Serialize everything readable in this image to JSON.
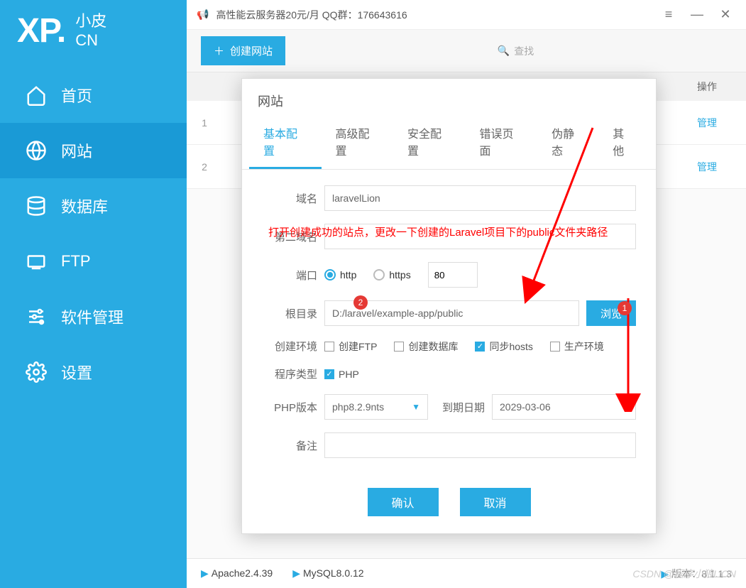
{
  "logo": {
    "xp": "XP.",
    "sub1": "小皮",
    "sub2": "CN"
  },
  "nav": {
    "home": "首页",
    "website": "网站",
    "database": "数据库",
    "ftp": "FTP",
    "software": "软件管理",
    "settings": "设置"
  },
  "titlebar": {
    "announce": "高性能云服务器20元/月  QQ群：176643616"
  },
  "topbar": {
    "create": "创建网站",
    "search": "查找"
  },
  "table": {
    "op_header": "操作",
    "manage": "管理",
    "rows": [
      "1",
      "2"
    ]
  },
  "dialog": {
    "title": "网站",
    "tabs": {
      "basic": "基本配置",
      "advanced": "高级配置",
      "security": "安全配置",
      "error": "错误页面",
      "rewrite": "伪静态",
      "other": "其他"
    },
    "labels": {
      "domain": "域名",
      "domain2": "第二域名",
      "port": "端口",
      "root": "根目录",
      "env": "创建环境",
      "type": "程序类型",
      "phpver": "PHP版本",
      "expire": "到期日期",
      "remark": "备注"
    },
    "values": {
      "domain": "laravelLion",
      "domain2": "",
      "http": "http",
      "https": "https",
      "port": "80",
      "root": "D:/laravel/example-app/public",
      "browse": "浏览",
      "ftp": "创建FTP",
      "createdb": "创建数据库",
      "hosts": "同步hosts",
      "prod": "生产环境",
      "php": "PHP",
      "phpver": "php8.2.9nts",
      "expire": "2029-03-06",
      "remark": ""
    },
    "actions": {
      "ok": "确认",
      "cancel": "取消"
    }
  },
  "annotations": {
    "note": "打开创建成功的站点，更改一下创建的Laravel项目下的public文件夹路径",
    "badge1": "1",
    "badge2": "2"
  },
  "statusbar": {
    "apache": "Apache2.4.39",
    "mysql": "MySQL8.0.12",
    "version_label": "版本：",
    "version": "8.1.1.3"
  },
  "watermark": "CSDN @程序小狼LiON"
}
